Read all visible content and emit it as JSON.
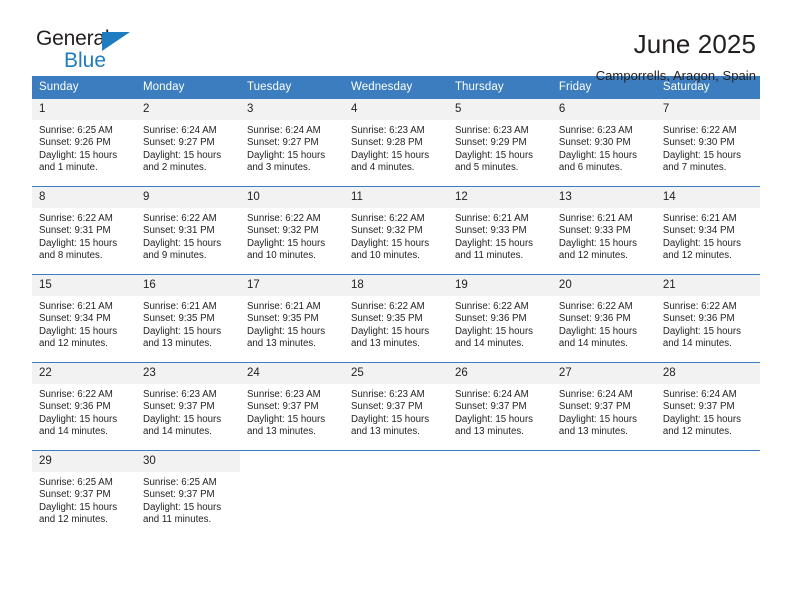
{
  "logo": {
    "word_top": "General",
    "word_bottom": "Blue",
    "triangle_color": "#1f7cc0",
    "icon": "triangle-icon"
  },
  "header": {
    "title": "June 2025",
    "subtitle": "Camporrells, Aragon, Spain"
  },
  "colors": {
    "header_blue": "#3b7dbf",
    "daynum_gray": "#f2f2f2",
    "text": "#231f20",
    "logo_blue": "#1f7cc0"
  },
  "weekdays": [
    "Sunday",
    "Monday",
    "Tuesday",
    "Wednesday",
    "Thursday",
    "Friday",
    "Saturday"
  ],
  "weeks": [
    [
      {
        "day": "1",
        "sunrise": "Sunrise: 6:25 AM",
        "sunset": "Sunset: 9:26 PM",
        "daylight1": "Daylight: 15 hours",
        "daylight2": "and 1 minute."
      },
      {
        "day": "2",
        "sunrise": "Sunrise: 6:24 AM",
        "sunset": "Sunset: 9:27 PM",
        "daylight1": "Daylight: 15 hours",
        "daylight2": "and 2 minutes."
      },
      {
        "day": "3",
        "sunrise": "Sunrise: 6:24 AM",
        "sunset": "Sunset: 9:27 PM",
        "daylight1": "Daylight: 15 hours",
        "daylight2": "and 3 minutes."
      },
      {
        "day": "4",
        "sunrise": "Sunrise: 6:23 AM",
        "sunset": "Sunset: 9:28 PM",
        "daylight1": "Daylight: 15 hours",
        "daylight2": "and 4 minutes."
      },
      {
        "day": "5",
        "sunrise": "Sunrise: 6:23 AM",
        "sunset": "Sunset: 9:29 PM",
        "daylight1": "Daylight: 15 hours",
        "daylight2": "and 5 minutes."
      },
      {
        "day": "6",
        "sunrise": "Sunrise: 6:23 AM",
        "sunset": "Sunset: 9:30 PM",
        "daylight1": "Daylight: 15 hours",
        "daylight2": "and 6 minutes."
      },
      {
        "day": "7",
        "sunrise": "Sunrise: 6:22 AM",
        "sunset": "Sunset: 9:30 PM",
        "daylight1": "Daylight: 15 hours",
        "daylight2": "and 7 minutes."
      }
    ],
    [
      {
        "day": "8",
        "sunrise": "Sunrise: 6:22 AM",
        "sunset": "Sunset: 9:31 PM",
        "daylight1": "Daylight: 15 hours",
        "daylight2": "and 8 minutes."
      },
      {
        "day": "9",
        "sunrise": "Sunrise: 6:22 AM",
        "sunset": "Sunset: 9:31 PM",
        "daylight1": "Daylight: 15 hours",
        "daylight2": "and 9 minutes."
      },
      {
        "day": "10",
        "sunrise": "Sunrise: 6:22 AM",
        "sunset": "Sunset: 9:32 PM",
        "daylight1": "Daylight: 15 hours",
        "daylight2": "and 10 minutes."
      },
      {
        "day": "11",
        "sunrise": "Sunrise: 6:22 AM",
        "sunset": "Sunset: 9:32 PM",
        "daylight1": "Daylight: 15 hours",
        "daylight2": "and 10 minutes."
      },
      {
        "day": "12",
        "sunrise": "Sunrise: 6:21 AM",
        "sunset": "Sunset: 9:33 PM",
        "daylight1": "Daylight: 15 hours",
        "daylight2": "and 11 minutes."
      },
      {
        "day": "13",
        "sunrise": "Sunrise: 6:21 AM",
        "sunset": "Sunset: 9:33 PM",
        "daylight1": "Daylight: 15 hours",
        "daylight2": "and 12 minutes."
      },
      {
        "day": "14",
        "sunrise": "Sunrise: 6:21 AM",
        "sunset": "Sunset: 9:34 PM",
        "daylight1": "Daylight: 15 hours",
        "daylight2": "and 12 minutes."
      }
    ],
    [
      {
        "day": "15",
        "sunrise": "Sunrise: 6:21 AM",
        "sunset": "Sunset: 9:34 PM",
        "daylight1": "Daylight: 15 hours",
        "daylight2": "and 12 minutes."
      },
      {
        "day": "16",
        "sunrise": "Sunrise: 6:21 AM",
        "sunset": "Sunset: 9:35 PM",
        "daylight1": "Daylight: 15 hours",
        "daylight2": "and 13 minutes."
      },
      {
        "day": "17",
        "sunrise": "Sunrise: 6:21 AM",
        "sunset": "Sunset: 9:35 PM",
        "daylight1": "Daylight: 15 hours",
        "daylight2": "and 13 minutes."
      },
      {
        "day": "18",
        "sunrise": "Sunrise: 6:22 AM",
        "sunset": "Sunset: 9:35 PM",
        "daylight1": "Daylight: 15 hours",
        "daylight2": "and 13 minutes."
      },
      {
        "day": "19",
        "sunrise": "Sunrise: 6:22 AM",
        "sunset": "Sunset: 9:36 PM",
        "daylight1": "Daylight: 15 hours",
        "daylight2": "and 14 minutes."
      },
      {
        "day": "20",
        "sunrise": "Sunrise: 6:22 AM",
        "sunset": "Sunset: 9:36 PM",
        "daylight1": "Daylight: 15 hours",
        "daylight2": "and 14 minutes."
      },
      {
        "day": "21",
        "sunrise": "Sunrise: 6:22 AM",
        "sunset": "Sunset: 9:36 PM",
        "daylight1": "Daylight: 15 hours",
        "daylight2": "and 14 minutes."
      }
    ],
    [
      {
        "day": "22",
        "sunrise": "Sunrise: 6:22 AM",
        "sunset": "Sunset: 9:36 PM",
        "daylight1": "Daylight: 15 hours",
        "daylight2": "and 14 minutes."
      },
      {
        "day": "23",
        "sunrise": "Sunrise: 6:23 AM",
        "sunset": "Sunset: 9:37 PM",
        "daylight1": "Daylight: 15 hours",
        "daylight2": "and 14 minutes."
      },
      {
        "day": "24",
        "sunrise": "Sunrise: 6:23 AM",
        "sunset": "Sunset: 9:37 PM",
        "daylight1": "Daylight: 15 hours",
        "daylight2": "and 13 minutes."
      },
      {
        "day": "25",
        "sunrise": "Sunrise: 6:23 AM",
        "sunset": "Sunset: 9:37 PM",
        "daylight1": "Daylight: 15 hours",
        "daylight2": "and 13 minutes."
      },
      {
        "day": "26",
        "sunrise": "Sunrise: 6:24 AM",
        "sunset": "Sunset: 9:37 PM",
        "daylight1": "Daylight: 15 hours",
        "daylight2": "and 13 minutes."
      },
      {
        "day": "27",
        "sunrise": "Sunrise: 6:24 AM",
        "sunset": "Sunset: 9:37 PM",
        "daylight1": "Daylight: 15 hours",
        "daylight2": "and 13 minutes."
      },
      {
        "day": "28",
        "sunrise": "Sunrise: 6:24 AM",
        "sunset": "Sunset: 9:37 PM",
        "daylight1": "Daylight: 15 hours",
        "daylight2": "and 12 minutes."
      }
    ],
    [
      {
        "day": "29",
        "sunrise": "Sunrise: 6:25 AM",
        "sunset": "Sunset: 9:37 PM",
        "daylight1": "Daylight: 15 hours",
        "daylight2": "and 12 minutes."
      },
      {
        "day": "30",
        "sunrise": "Sunrise: 6:25 AM",
        "sunset": "Sunset: 9:37 PM",
        "daylight1": "Daylight: 15 hours",
        "daylight2": "and 11 minutes."
      },
      {
        "day": "",
        "sunrise": "",
        "sunset": "",
        "daylight1": "",
        "daylight2": ""
      },
      {
        "day": "",
        "sunrise": "",
        "sunset": "",
        "daylight1": "",
        "daylight2": ""
      },
      {
        "day": "",
        "sunrise": "",
        "sunset": "",
        "daylight1": "",
        "daylight2": ""
      },
      {
        "day": "",
        "sunrise": "",
        "sunset": "",
        "daylight1": "",
        "daylight2": ""
      },
      {
        "day": "",
        "sunrise": "",
        "sunset": "",
        "daylight1": "",
        "daylight2": ""
      }
    ]
  ]
}
